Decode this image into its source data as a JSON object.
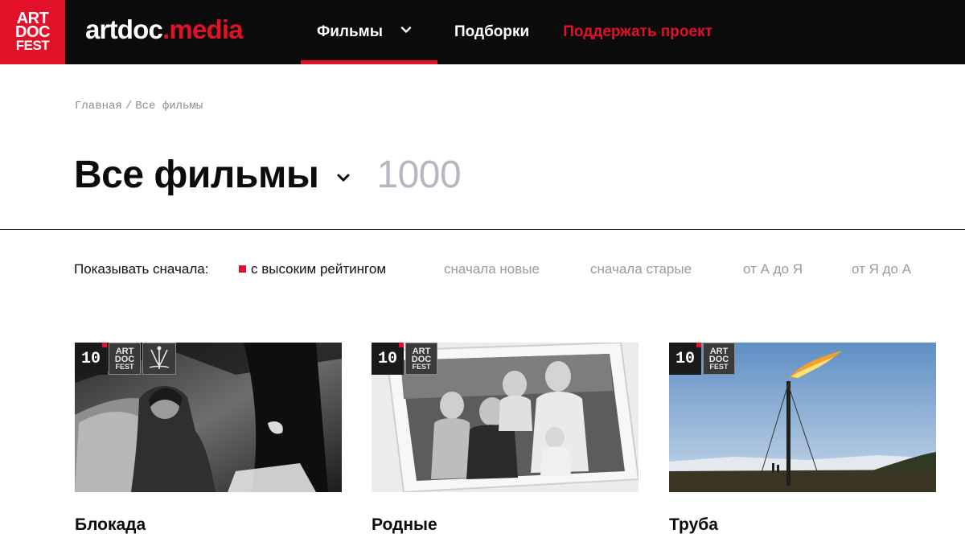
{
  "colors": {
    "accent": "#e3102a",
    "header_bg": "#0b0b0b",
    "muted": "#9a9aa3",
    "count": "#b7b7c4"
  },
  "header": {
    "logo": {
      "line1": "ART",
      "line2": "DOC",
      "line3": "FEST"
    },
    "brand": {
      "part1": "artdoc",
      "part2": ".media"
    },
    "nav": {
      "films": "Фильмы",
      "collections": "Подборки",
      "support": "Поддержать проект"
    }
  },
  "breadcrumb": {
    "home": "Главная",
    "separator": "/",
    "current": "Все фильмы"
  },
  "title": {
    "text": "Все фильмы",
    "count": "1000"
  },
  "sort": {
    "label": "Показывать сначала:",
    "options": [
      "с высоким рейтингом",
      "сначала новые",
      "сначала старые",
      "от А до Я",
      "от Я до А"
    ],
    "active_index": 0
  },
  "cards": [
    {
      "title": "Блокада",
      "rating": "10",
      "fest_badge": {
        "line1": "ART",
        "line2": "DOC",
        "line3": "FEST"
      },
      "has_laurel": true,
      "icons": [
        "artdocfest-badge-icon",
        "laurel-icon"
      ]
    },
    {
      "title": "Родные",
      "rating": "10",
      "fest_badge": {
        "line1": "ART",
        "line2": "DOC",
        "line3": "FEST"
      },
      "has_laurel": false,
      "icons": [
        "artdocfest-badge-icon"
      ]
    },
    {
      "title": "Труба",
      "rating": "10",
      "fest_badge": {
        "line1": "ART",
        "line2": "DOC",
        "line3": "FEST"
      },
      "has_laurel": false,
      "icons": [
        "artdocfest-badge-icon"
      ]
    }
  ]
}
